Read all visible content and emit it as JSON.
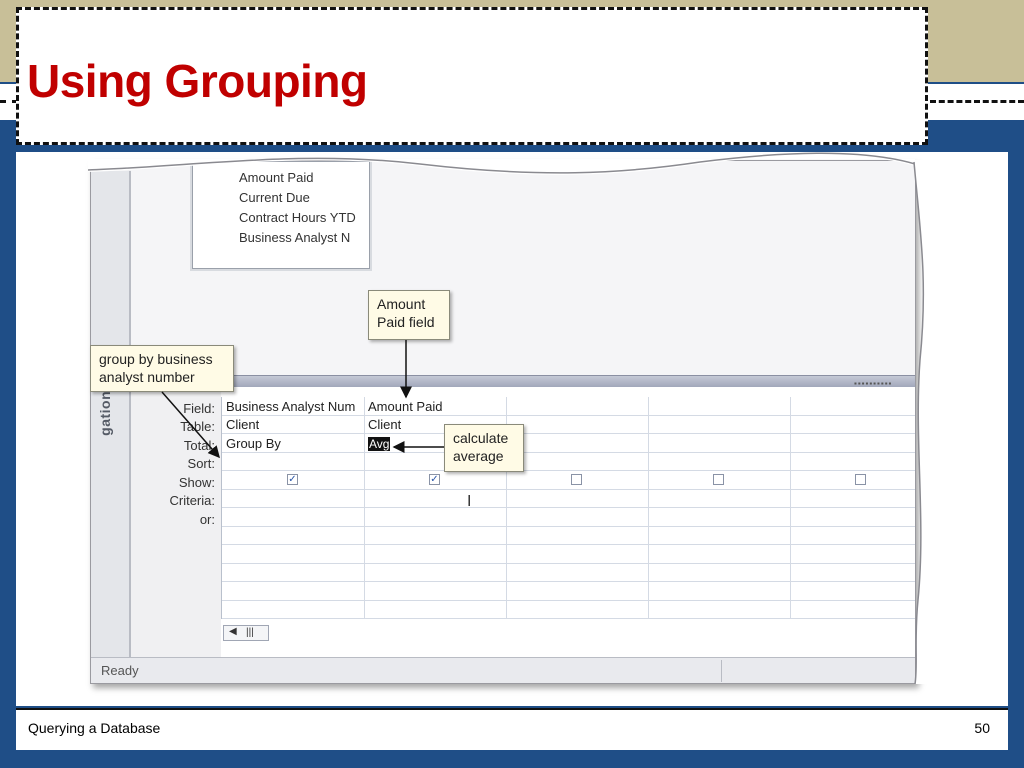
{
  "slide": {
    "title": "Using Grouping",
    "footer_left": "Querying a Database",
    "page_number": "50"
  },
  "field_list": {
    "items": [
      "Amount Paid",
      "Current Due",
      "Contract Hours YTD",
      "Business Analyst N"
    ]
  },
  "nav_pane": {
    "label": "gation Pane"
  },
  "design_grid": {
    "row_labels": [
      "Field:",
      "Table:",
      "Total:",
      "Sort:",
      "Show:",
      "Criteria:",
      "or:"
    ],
    "columns": [
      {
        "field": "Business Analyst Num",
        "table": "Client",
        "total": "Group By",
        "show": true
      },
      {
        "field": "Amount Paid",
        "table": "Client",
        "total": "Avg",
        "show": true
      },
      {
        "field": "",
        "table": "",
        "total": "",
        "show": false
      },
      {
        "field": "",
        "table": "",
        "total": "",
        "show": false
      },
      {
        "field": "",
        "table": "",
        "total": "",
        "show": false
      }
    ]
  },
  "status_bar": {
    "text": "Ready"
  },
  "callouts": {
    "amount_paid": {
      "line1": "Amount",
      "line2": "Paid field"
    },
    "group_by": {
      "line1": "group by business",
      "line2": "analyst number"
    },
    "calculate": {
      "line1": "calculate",
      "line2": "average"
    }
  },
  "colors": {
    "title": "#c00000",
    "navy": "#1f4e87",
    "tan": "#c8bf98",
    "callout_bg": "#fffbe6"
  }
}
